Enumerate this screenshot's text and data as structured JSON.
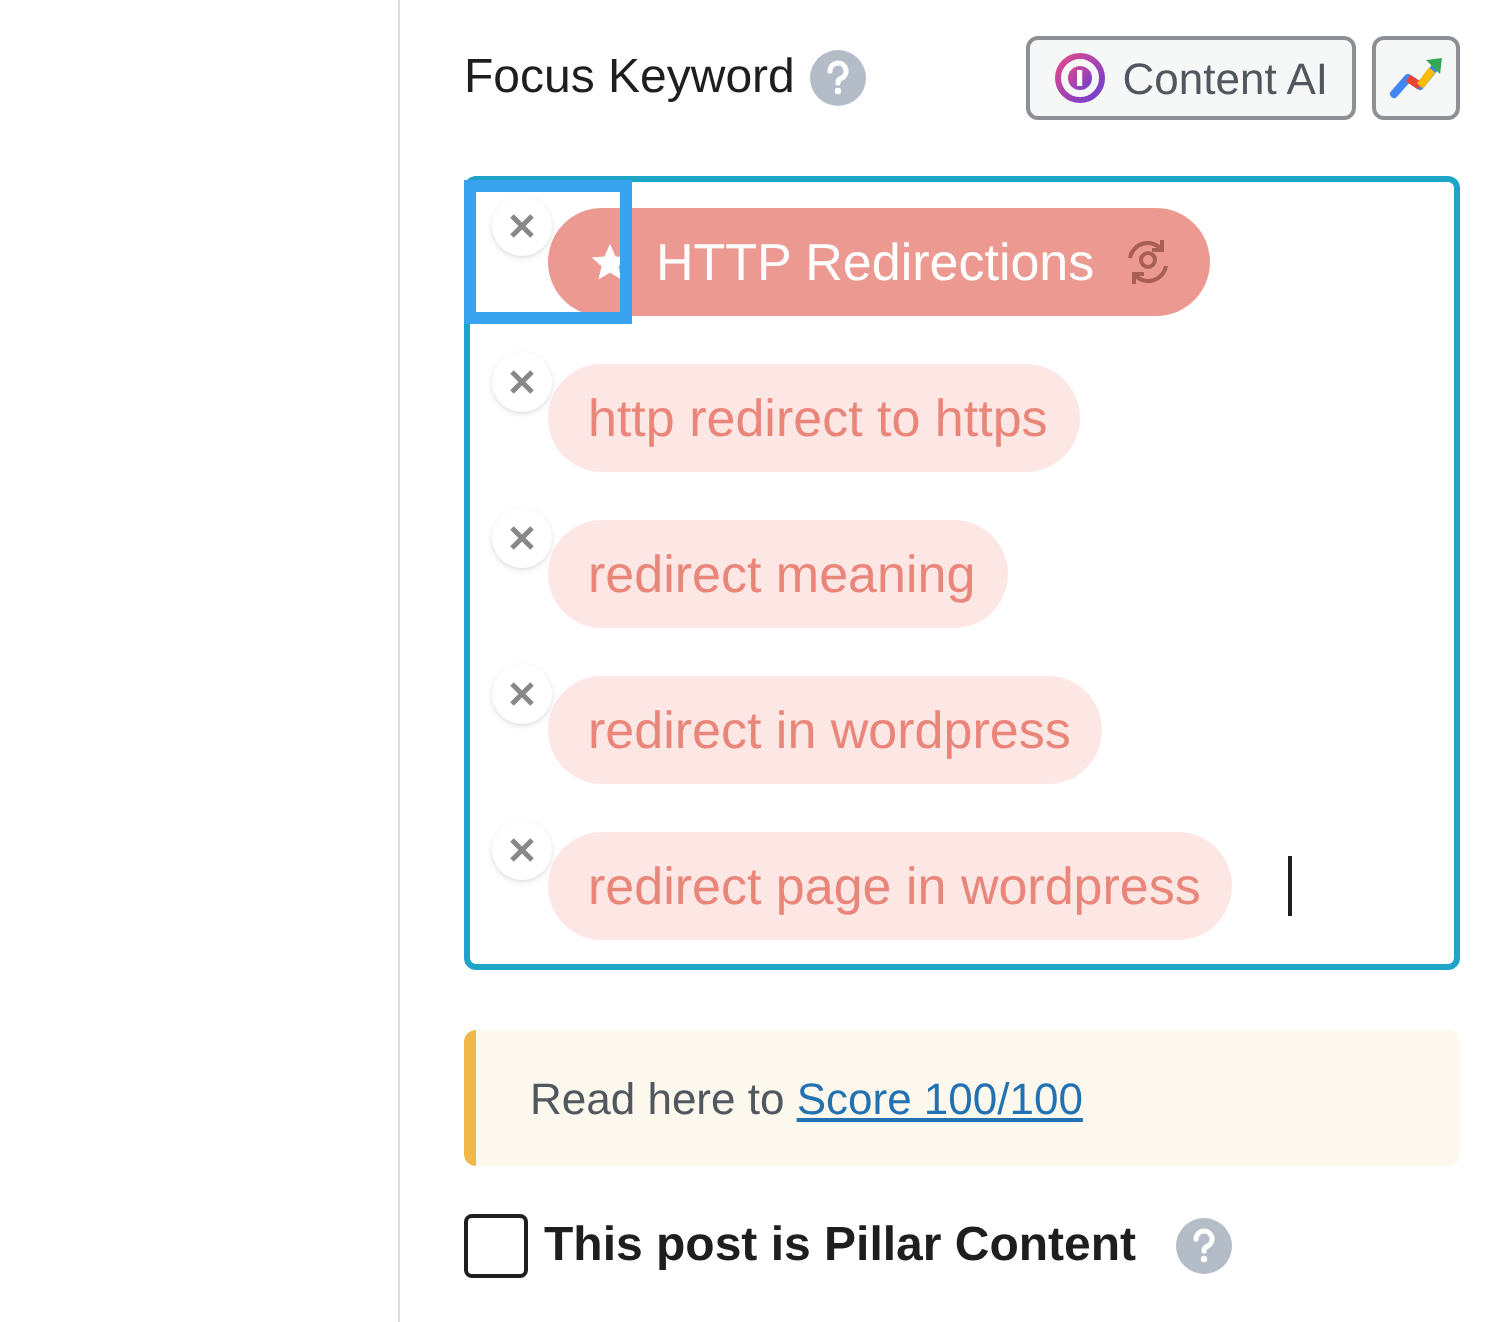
{
  "heading": {
    "label": "Focus Keyword"
  },
  "buttons": [
    {
      "kind": "content-ai",
      "label": "Content AI"
    },
    {
      "kind": "trends"
    }
  ],
  "keywords": [
    {
      "text": "HTTP Redirections",
      "primary": true
    },
    {
      "text": "http redirect to https",
      "primary": false
    },
    {
      "text": "redirect meaning",
      "primary": false
    },
    {
      "text": "redirect in wordpress",
      "primary": false
    },
    {
      "text": "redirect page in wordpress",
      "primary": false
    }
  ],
  "notice": {
    "text": "Read here to",
    "link": "Score 100/100"
  },
  "pillar": {
    "label": "This post is Pillar Content",
    "checked": false
  }
}
